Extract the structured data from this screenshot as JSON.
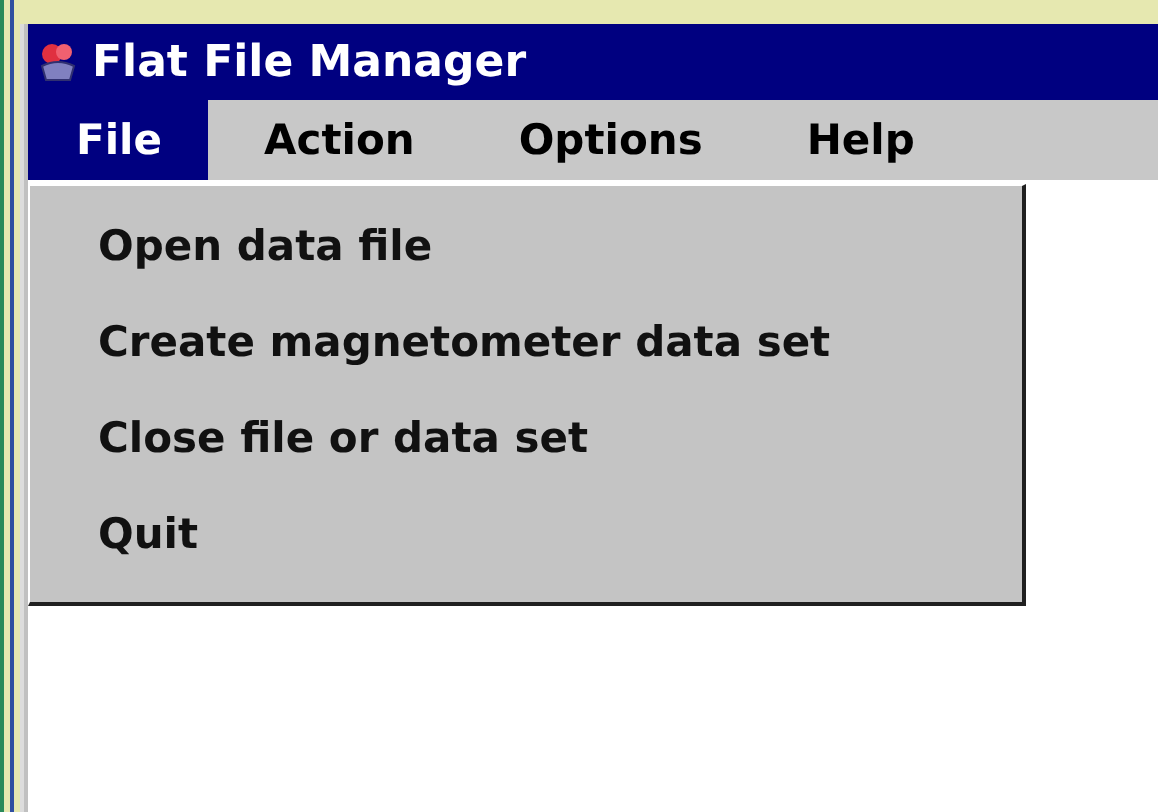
{
  "window": {
    "title": "Flat File Manager"
  },
  "menu_bar": [
    {
      "label": "File",
      "selected": true
    },
    {
      "label": "Action",
      "selected": false
    },
    {
      "label": "Options",
      "selected": false
    },
    {
      "label": "Help",
      "selected": false
    }
  ],
  "menu": {
    "items": [
      {
        "label": "Open data file"
      },
      {
        "label": "Create magnetometer data set"
      },
      {
        "label": "Close file or data set"
      },
      {
        "label": "Quit"
      }
    ]
  }
}
